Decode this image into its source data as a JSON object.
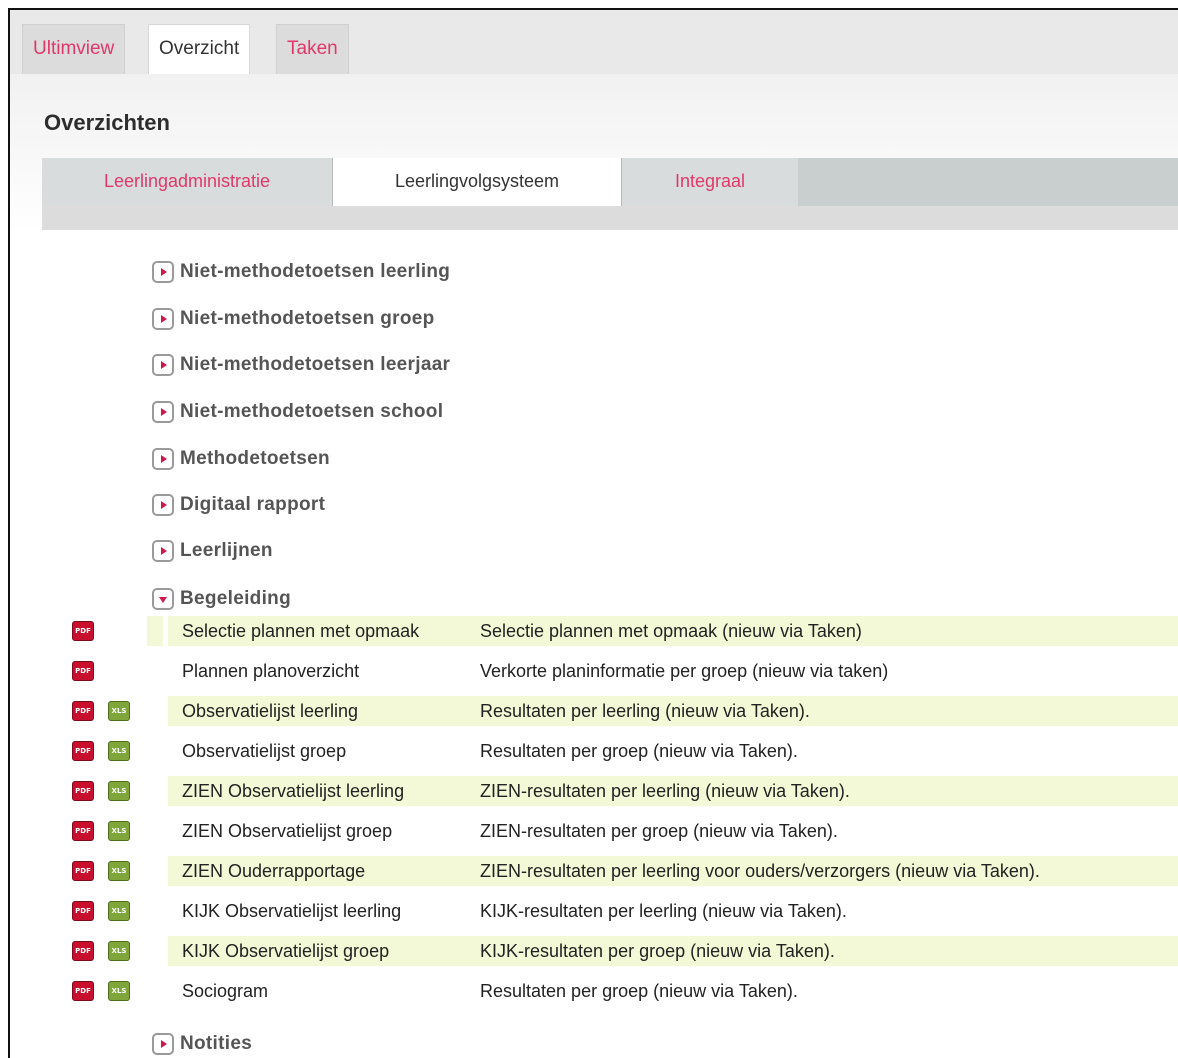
{
  "top_tabs": [
    {
      "label": "Ultimview",
      "active": false
    },
    {
      "label": "Overzicht",
      "active": true
    },
    {
      "label": "Taken",
      "active": false
    }
  ],
  "page_title": "Overzichten",
  "sub_tabs": [
    {
      "label": "Leerlingadministratie",
      "active": false
    },
    {
      "label": "Leerlingvolgsysteem",
      "active": true
    },
    {
      "label": "Integraal",
      "active": false
    }
  ],
  "sections": [
    {
      "label": "Niet-methodetoetsen leerling",
      "expanded": false
    },
    {
      "label": "Niet-methodetoetsen groep",
      "expanded": false
    },
    {
      "label": "Niet-methodetoetsen leerjaar",
      "expanded": false
    },
    {
      "label": "Niet-methodetoetsen school",
      "expanded": false
    },
    {
      "label": "Methodetoetsen",
      "expanded": false
    },
    {
      "label": "Digitaal rapport",
      "expanded": false
    },
    {
      "label": "Leerlijnen",
      "expanded": false
    },
    {
      "label": "Begeleiding",
      "expanded": true
    }
  ],
  "reports": [
    {
      "name": "Selectie plannen met opmaak",
      "description": "Selectie plannen met opmaak (nieuw via Taken)",
      "pdf": true,
      "xls": false
    },
    {
      "name": "Plannen planoverzicht",
      "description": "Verkorte planinformatie per groep (nieuw via taken)",
      "pdf": true,
      "xls": false
    },
    {
      "name": "Observatielijst leerling",
      "description": "Resultaten per leerling (nieuw via Taken).",
      "pdf": true,
      "xls": true
    },
    {
      "name": "Observatielijst groep",
      "description": "Resultaten per groep (nieuw via Taken).",
      "pdf": true,
      "xls": true
    },
    {
      "name": "ZIEN Observatielijst leerling",
      "description": "ZIEN-resultaten per leerling (nieuw via Taken).",
      "pdf": true,
      "xls": true
    },
    {
      "name": "ZIEN Observatielijst groep",
      "description": "ZIEN-resultaten per groep (nieuw via Taken).",
      "pdf": true,
      "xls": true
    },
    {
      "name": "ZIEN Ouderrapportage",
      "description": "ZIEN-resultaten per leerling voor ouders/verzorgers (nieuw via Taken).",
      "pdf": true,
      "xls": true
    },
    {
      "name": "KIJK Observatielijst leerling",
      "description": "KIJK-resultaten per leerling (nieuw via Taken).",
      "pdf": true,
      "xls": true
    },
    {
      "name": "KIJK Observatielijst groep",
      "description": "KIJK-resultaten per groep (nieuw via Taken).",
      "pdf": true,
      "xls": true
    },
    {
      "name": "Sociogram",
      "description": "Resultaten per groep (nieuw via Taken).",
      "pdf": true,
      "xls": true
    }
  ],
  "after_section": {
    "label": "Notities",
    "expanded": false
  },
  "icons": {
    "pdf_text": "PDF",
    "xls_text": "XLS"
  },
  "colors": {
    "accent": "#e0386b",
    "row_highlight": "#f3f9d6",
    "pdf_red": "#c8102e",
    "xls_green": "#7fa63b"
  }
}
